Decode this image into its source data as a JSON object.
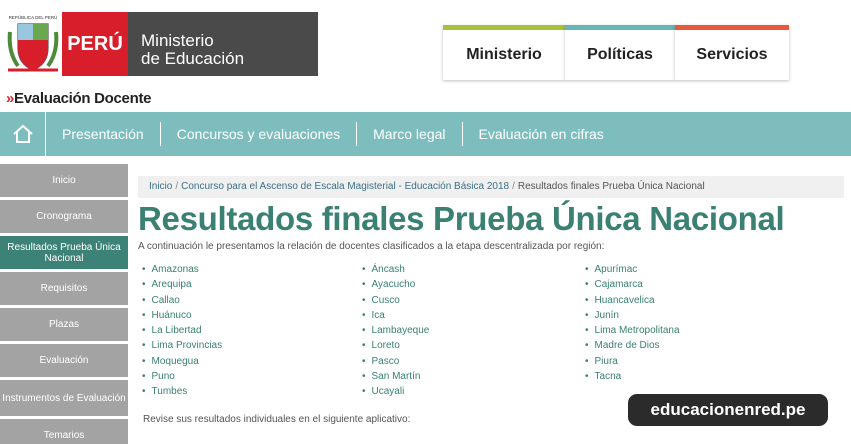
{
  "header": {
    "shield_text": "REPÚBLICA DEL PERÚ",
    "country": "PERÚ",
    "ministry_line1": "Ministerio",
    "ministry_line2": "de Educación"
  },
  "topnav": [
    "Ministerio",
    "Políticas",
    "Servicios"
  ],
  "section_title": "Evaluación Docente",
  "mainnav": [
    "Presentación",
    "Concursos y evaluaciones",
    "Marco legal",
    "Evaluación en cifras"
  ],
  "sidebar": [
    "Inicio",
    "Cronograma",
    "Resultados Prueba Única Nacional",
    "Requisitos",
    "Plazas",
    "Evaluación",
    "Instrumentos de Evaluación",
    "Temarios"
  ],
  "breadcrumb": [
    "Inicio",
    "Concurso para el Ascenso de Escala Magisterial - Educación Básica 2018",
    "Resultados finales Prueba Única Nacional"
  ],
  "page_title": "Resultados finales Prueba Única Nacional",
  "intro": "A continuación le presentamos la relación de docentes clasificados a la etapa descentralizada por región:",
  "regions": {
    "col1": [
      "Amazonas",
      "Arequipa",
      "Callao",
      "Huánuco",
      "La Libertad",
      "Lima Provincias",
      "Moquegua",
      "Puno",
      "Tumbes"
    ],
    "col2": [
      "Áncash",
      "Ayacucho",
      "Cusco",
      "Ica",
      "Lambayeque",
      "Loreto",
      "Pasco",
      "San Martín",
      "Ucayali"
    ],
    "col3": [
      "Apurímac",
      "Cajamarca",
      "Huancavelica",
      "Junín",
      "Lima Metropolitana",
      "Madre de Dios",
      "Piura",
      "Tacna"
    ]
  },
  "revise": "Revise sus resultados individuales en el siguiente aplicativo:",
  "watermark": "educacionenred.pe",
  "colors": {
    "brand_red": "#d81e2b",
    "nav_teal": "#7ebdbe",
    "active_green": "#3d8276",
    "title_green": "#3a8073"
  },
  "icons": [
    "shield-icon",
    "home-icon"
  ]
}
